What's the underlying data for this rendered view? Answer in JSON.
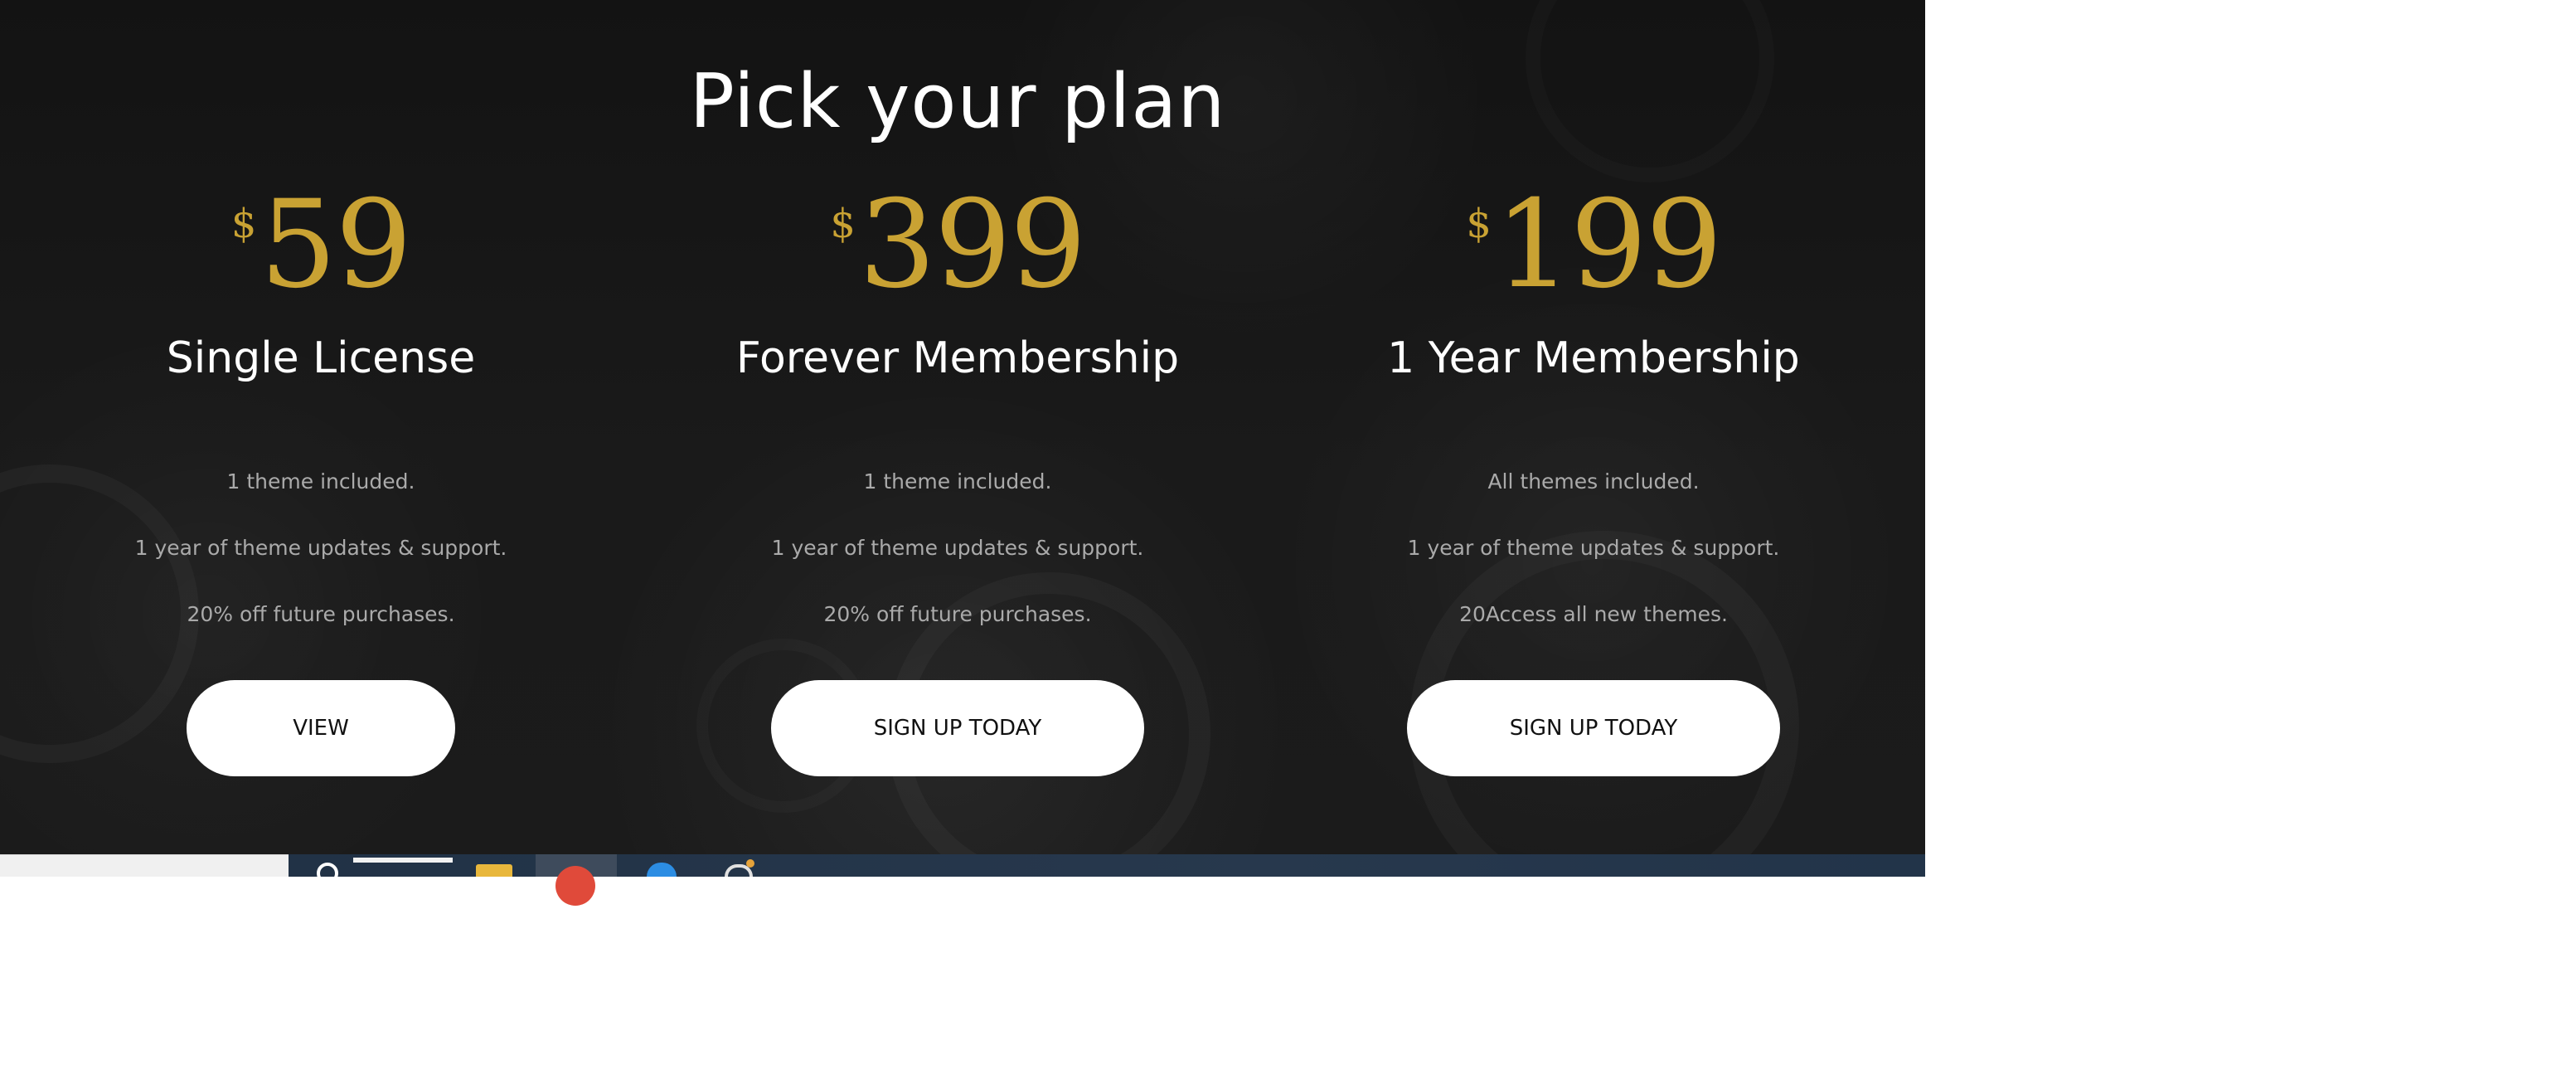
{
  "page": {
    "title": "Pick your plan"
  },
  "colors": {
    "background": "#161616",
    "price_gold": "#c9a233",
    "title_white": "#ffffff",
    "feature_gray": "#aaaaaa",
    "button_bg": "#ffffff",
    "button_text": "#111111",
    "taskbar": "#243549"
  },
  "plans": [
    {
      "currency": "$",
      "price": "59",
      "name": "Single License",
      "features": [
        "1 theme included.",
        "1 year of theme updates & support.",
        "20% off future purchases."
      ],
      "button_label": "VIEW"
    },
    {
      "currency": "$",
      "price": "399",
      "name": "Forever Membership",
      "features": [
        "1 theme included.",
        "1 year of theme updates & support.",
        "20% off future purchases."
      ],
      "button_label": "SIGN UP TODAY"
    },
    {
      "currency": "$",
      "price": "199",
      "name": "1 Year Membership",
      "features": [
        "All themes included.",
        "1 year of theme updates & support.",
        "20Access all new themes."
      ],
      "button_label": "SIGN UP TODAY"
    }
  ],
  "taskbar": {
    "icons": [
      "search-icon",
      "file-explorer-icon",
      "chrome-icon",
      "edge-icon",
      "app-icon"
    ]
  }
}
